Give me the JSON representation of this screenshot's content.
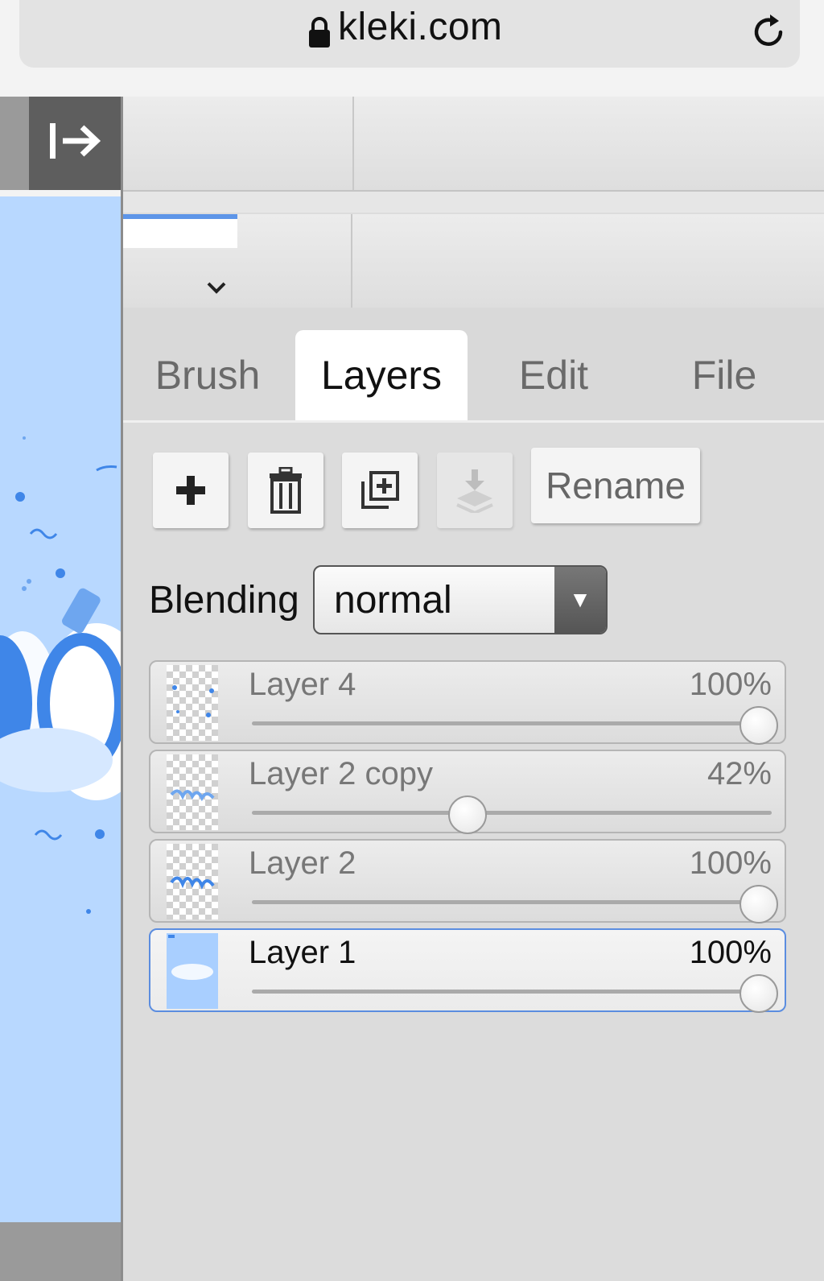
{
  "browser": {
    "url": "kleki.com",
    "lock_icon": "lock-icon",
    "reload_icon": "reload-icon"
  },
  "sidebar": {
    "collapse_icon": "collapse-right-icon"
  },
  "tabs": [
    {
      "label": "Brush",
      "active": false
    },
    {
      "label": "Layers",
      "active": true
    },
    {
      "label": "Edit",
      "active": false
    },
    {
      "label": "File",
      "active": false
    }
  ],
  "layer_actions": {
    "add_icon": "plus-icon",
    "delete_icon": "trash-icon",
    "duplicate_icon": "duplicate-icon",
    "merge_icon": "merge-down-icon",
    "rename_label": "Rename"
  },
  "blending": {
    "label": "Blending",
    "value": "normal"
  },
  "layers": [
    {
      "name": "Layer 4",
      "opacity_label": "100%",
      "opacity": 1.0,
      "selected": false
    },
    {
      "name": "Layer 2 copy",
      "opacity_label": "42%",
      "opacity": 0.42,
      "selected": false
    },
    {
      "name": "Layer 2",
      "opacity_label": "100%",
      "opacity": 1.0,
      "selected": false
    },
    {
      "name": "Layer 1",
      "opacity_label": "100%",
      "opacity": 1.0,
      "selected": true
    }
  ],
  "colors": {
    "accent": "#5d95e8",
    "canvas": "#b8d8ff",
    "art": "#3f86e8"
  }
}
